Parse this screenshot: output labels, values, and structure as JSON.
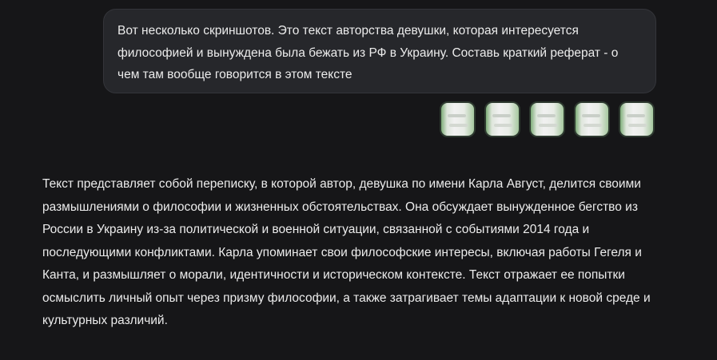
{
  "conversation": {
    "user_message": {
      "text": "Вот несколько скриншотов. Это текст авторства девушки, которая интересуется философией и вынуждена была бежать из РФ в Украину. Составь краткий реферат - о чем там вообще говорится в этом тексте",
      "attachments": [
        {
          "type": "image",
          "icon": "screenshot-thumbnail"
        },
        {
          "type": "image",
          "icon": "screenshot-thumbnail"
        },
        {
          "type": "image",
          "icon": "screenshot-thumbnail"
        },
        {
          "type": "image",
          "icon": "screenshot-thumbnail"
        },
        {
          "type": "image",
          "icon": "screenshot-thumbnail"
        }
      ]
    },
    "assistant_message": {
      "text": "Текст представляет собой переписку, в которой автор, девушка по имени Карла Август, делится своими размышлениями о философии и жизненных обстоятельствах. Она обсуждает вынужденное бегство из России в Украину из-за политической и военной ситуации, связанной с событиями 2014 года и последующими конфликтами. Карла упоминает свои философские интересы, включая работы Гегеля и Канта, и размышляет о морали, идентичности и историческом контексте. Текст отражает ее попытки осмыслить личный опыт через призму философии, а также затрагивает темы адаптации к новой среде и культурных различий."
    }
  },
  "colors": {
    "background": "#161618",
    "user_bubble": "#26272b",
    "text": "#ececec"
  }
}
